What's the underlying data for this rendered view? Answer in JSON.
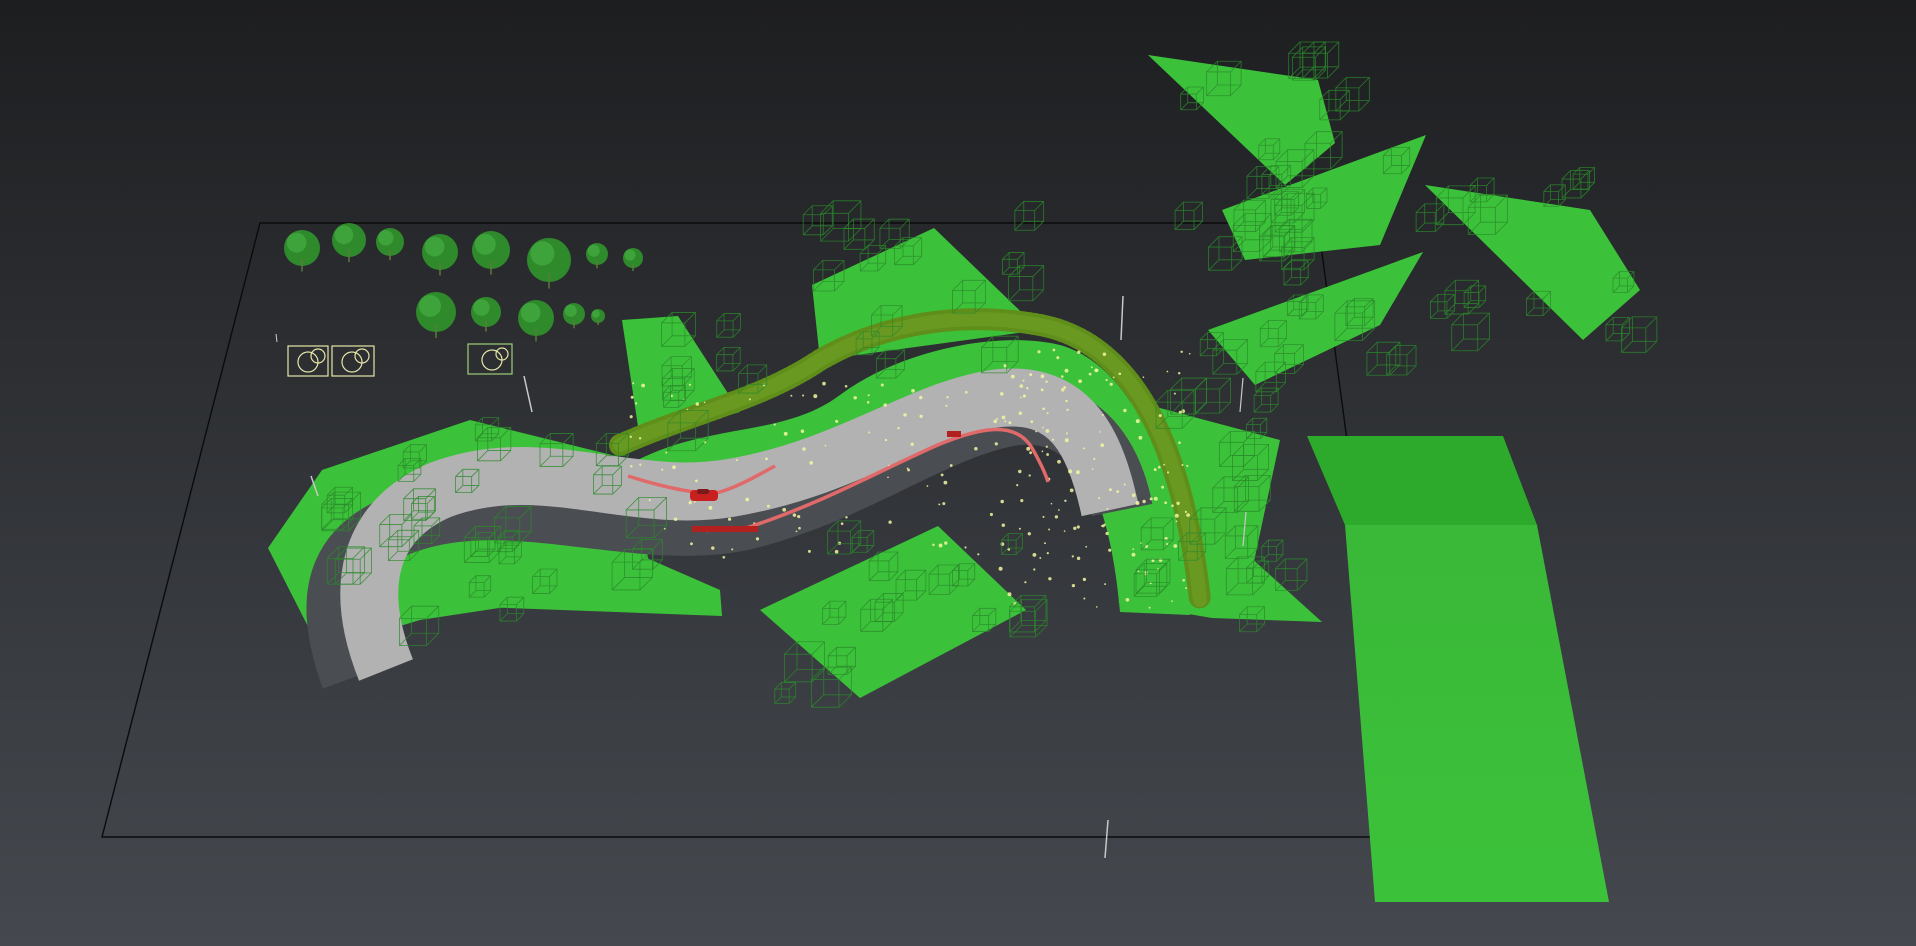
{
  "viewport": {
    "name": "3d-perspective-viewport",
    "background_top": "#1d1e20",
    "background_bottom": "#45494f"
  },
  "colors": {
    "terrain_green": "#3cc23a",
    "terrain_green_dark": "#2aa82a",
    "wireframe_green": "#2a8a2a",
    "road_gray": "#b2b2b2",
    "road_shadow": "#4a4d52",
    "hedge_green": "#5f8f1a",
    "barrier_red": "#e06a6a",
    "car_red": "#c8201e",
    "ground_plane_line": "#0b0b0b",
    "helper_yellow": "#e6e6a8",
    "flower_yellow": "#f4f6a0"
  },
  "scene_objects": [
    {
      "name": "ground-plane",
      "type": "plane-outline"
    },
    {
      "name": "curved-road",
      "type": "road"
    },
    {
      "name": "terrain-patches",
      "type": "terrain",
      "count": 11
    },
    {
      "name": "tree-library",
      "type": "foliage-assets",
      "count": 13
    },
    {
      "name": "helper-gizmos",
      "type": "helpers",
      "count": 3
    },
    {
      "name": "red-car",
      "type": "vehicle"
    },
    {
      "name": "road-barriers",
      "type": "barrier"
    },
    {
      "name": "hedge-row",
      "type": "hedge"
    },
    {
      "name": "green-block",
      "type": "box"
    }
  ]
}
